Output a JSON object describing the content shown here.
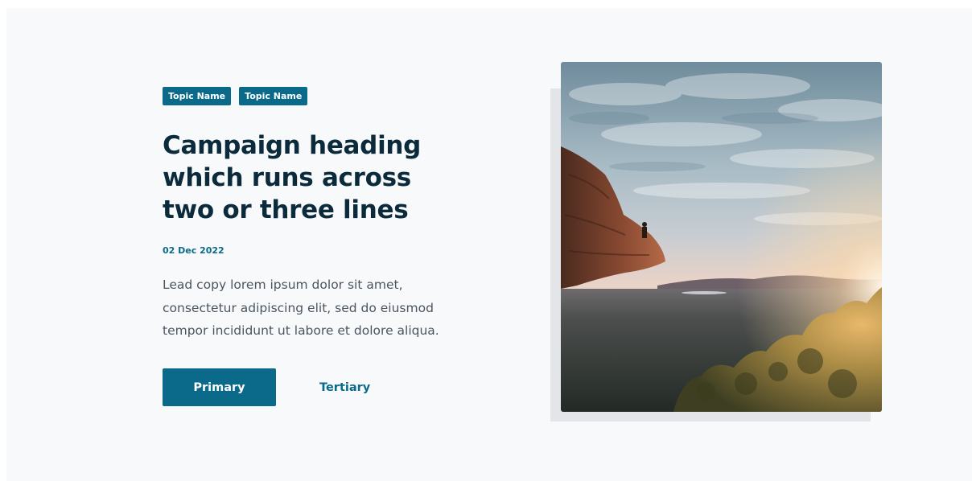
{
  "tags": [
    {
      "label": "Topic Name"
    },
    {
      "label": "Topic Name"
    }
  ],
  "heading": "Campaign heading which runs across two or three lines",
  "date": "02 Dec 2022",
  "lead": "Lead copy lorem ipsum dolor sit amet, consectetur adipiscing elit, sed do eiusmod tempor incididunt ut labore et dolore aliqua.",
  "actions": {
    "primary_label": "Primary",
    "tertiary_label": "Tertiary"
  },
  "media": {
    "alt": "Person sitting on a rocky cliff edge overlooking a valley at sunset"
  },
  "colors": {
    "accent": "#0b6a8a",
    "heading": "#0b2b3c",
    "background": "#f8f9fa"
  }
}
